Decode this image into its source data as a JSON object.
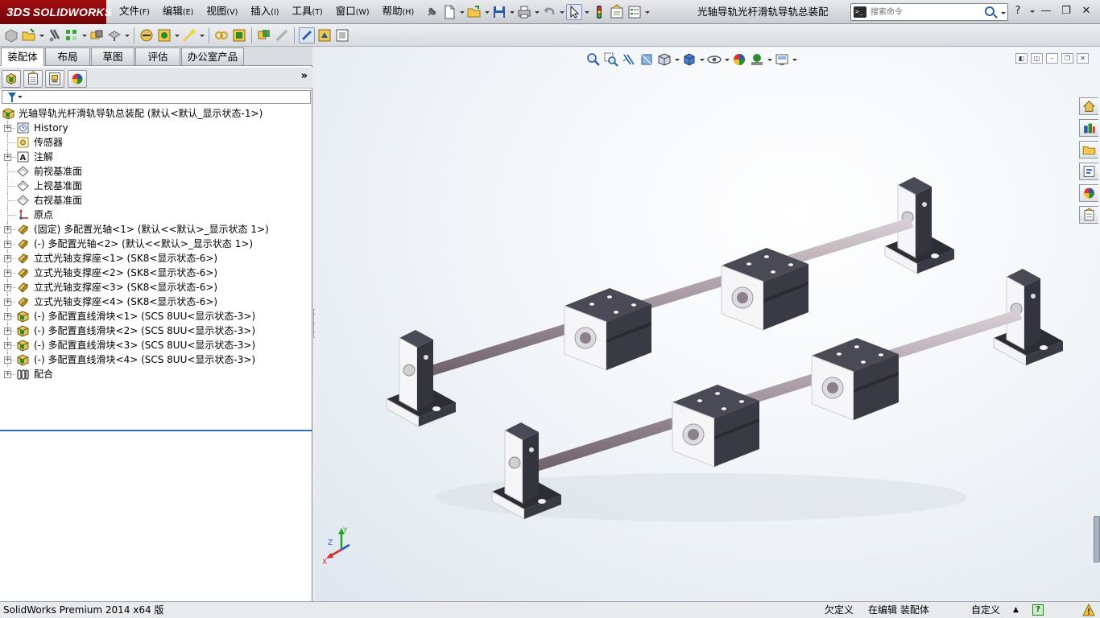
{
  "app": {
    "logo_text": "SOLIDWORKS",
    "logo_mark": "3DS",
    "document_title": "光轴导轨光杆滑轨导轨总装配"
  },
  "menu": [
    {
      "label": "文件",
      "key": "(F)"
    },
    {
      "label": "编辑",
      "key": "(E)"
    },
    {
      "label": "视图",
      "key": "(V)"
    },
    {
      "label": "插入",
      "key": "(I)"
    },
    {
      "label": "工具",
      "key": "(T)"
    },
    {
      "label": "窗口",
      "key": "(W)"
    },
    {
      "label": "帮助",
      "key": "(H)"
    }
  ],
  "command_search": {
    "placeholder": "搜索命令"
  },
  "command_manager_tabs": [
    {
      "label": "装配体",
      "active": true
    },
    {
      "label": "布局",
      "active": false
    },
    {
      "label": "草图",
      "active": false
    },
    {
      "label": "评估",
      "active": false
    },
    {
      "label": "办公室产品",
      "active": false
    }
  ],
  "feature_tree": [
    {
      "label": "光轴导轨光杆滑轨导轨总装配  (默认<默认_显示状态-1>)",
      "icon": "assembly-icon",
      "root": true
    },
    {
      "label": "History",
      "icon": "history-icon",
      "expandable": true
    },
    {
      "label": "传感器",
      "icon": "sensor-icon",
      "expandable": false
    },
    {
      "label": "注解",
      "icon": "annotation-icon",
      "expandable": true
    },
    {
      "label": "前视基准面",
      "icon": "plane-icon",
      "expandable": false
    },
    {
      "label": "上视基准面",
      "icon": "plane-icon",
      "expandable": false
    },
    {
      "label": "右视基准面",
      "icon": "plane-icon",
      "expandable": false
    },
    {
      "label": "原点",
      "icon": "origin-icon",
      "expandable": false
    },
    {
      "label": "(固定) 多配置光轴<1>  (默认<<默认>_显示状态 1>)",
      "icon": "part-icon",
      "expandable": true
    },
    {
      "label": "(-) 多配置光轴<2>  (默认<<默认>_显示状态 1>)",
      "icon": "part-icon",
      "expandable": true
    },
    {
      "label": "立式光轴支撑座<1>  (SK8<显示状态-6>)",
      "icon": "part-icon",
      "expandable": true
    },
    {
      "label": "立式光轴支撑座<2>  (SK8<显示状态-6>)",
      "icon": "part-icon",
      "expandable": true
    },
    {
      "label": "立式光轴支撑座<3>  (SK8<显示状态-6>)",
      "icon": "part-icon",
      "expandable": true
    },
    {
      "label": "立式光轴支撑座<4>  (SK8<显示状态-6>)",
      "icon": "part-icon",
      "expandable": true
    },
    {
      "label": "(-) 多配置直线滑块<1>  (SCS 8UU<显示状态-3>)",
      "icon": "subassembly-icon",
      "expandable": true
    },
    {
      "label": "(-) 多配置直线滑块<2>  (SCS 8UU<显示状态-3>)",
      "icon": "subassembly-icon",
      "expandable": true
    },
    {
      "label": "(-) 多配置直线滑块<3>  (SCS 8UU<显示状态-3>)",
      "icon": "subassembly-icon",
      "expandable": true
    },
    {
      "label": "(-) 多配置直线滑块<4>  (SCS 8UU<显示状态-3>)",
      "icon": "subassembly-icon",
      "expandable": true
    },
    {
      "label": "配合",
      "icon": "mates-icon",
      "expandable": true
    }
  ],
  "triad": {
    "x": "X",
    "y": "Y",
    "z": "Z"
  },
  "status_bar": {
    "product": "SolidWorks Premium 2014 x64 版",
    "definition": "欠定义",
    "editing": "在编辑 装配体",
    "units": "自定义",
    "help": "?"
  },
  "colors": {
    "accent": "#2e6fb8",
    "brand": "#a30d12",
    "block_body": "#3a3a44",
    "block_face": "#f4f4f6",
    "rod": "#b5a9b0"
  }
}
